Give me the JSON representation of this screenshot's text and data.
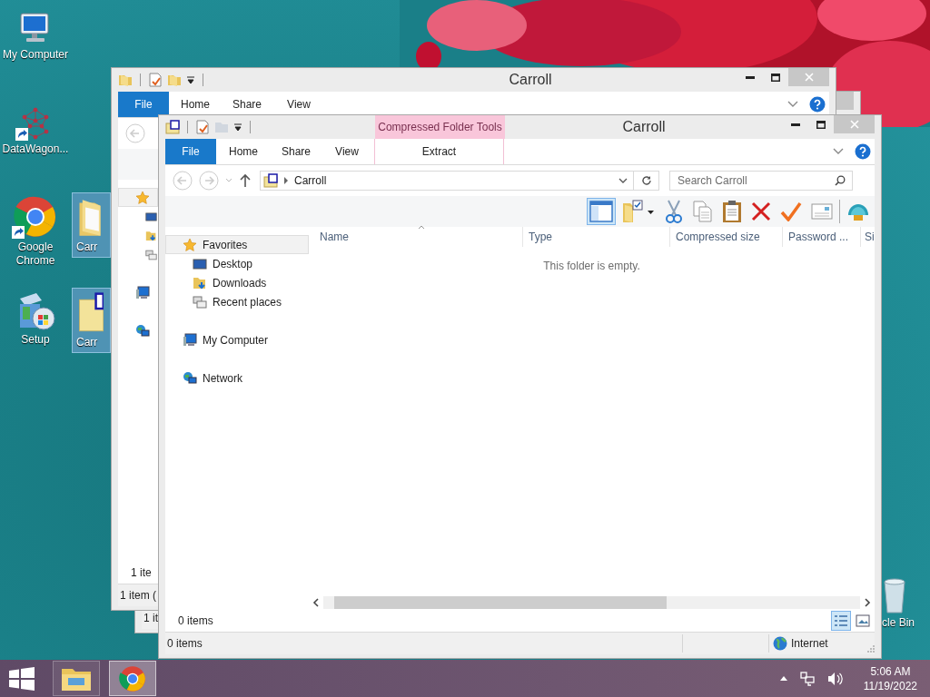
{
  "desktop_icons": [
    {
      "label": "My Computer",
      "kind": "computer",
      "selected": false,
      "shortcut": false
    },
    {
      "label": "DataWagon...",
      "kind": "mesh",
      "selected": false,
      "shortcut": true
    },
    {
      "label": "Google Chrome",
      "kind": "chrome",
      "selected": false,
      "shortcut": true
    },
    {
      "label": "Setup",
      "kind": "setup",
      "selected": false,
      "shortcut": false
    },
    {
      "label": "Carr",
      "kind": "folder",
      "selected": true,
      "shortcut": false
    },
    {
      "label": "Carr",
      "kind": "zip-folder",
      "selected": true,
      "shortcut": false
    },
    {
      "label": "cle Bin",
      "kind": "recycle-bin",
      "selected": false,
      "shortcut": false
    }
  ],
  "third_window": {
    "status": "1 it"
  },
  "back_window": {
    "title": "Carroll",
    "tabs": [
      {
        "label": "File",
        "kind": "file"
      },
      {
        "label": "Home",
        "kind": "tab"
      },
      {
        "label": "Share",
        "kind": "tab"
      },
      {
        "label": "View",
        "kind": "tab"
      }
    ],
    "item_count": "1 ite",
    "status": "1 item ("
  },
  "front_window": {
    "title": "Carroll",
    "context_group": "Compressed Folder Tools",
    "tabs": [
      {
        "label": "File",
        "kind": "file"
      },
      {
        "label": "Home",
        "kind": "tab"
      },
      {
        "label": "Share",
        "kind": "tab"
      },
      {
        "label": "View",
        "kind": "tab"
      },
      {
        "label": "Extract",
        "kind": "contextual"
      }
    ],
    "address": "Carroll",
    "search_placeholder": "Search Carroll",
    "toolbar": [
      {
        "kind": "pane",
        "selected": true
      },
      {
        "kind": "folder-check",
        "selected": false
      },
      {
        "kind": "cut",
        "selected": false
      },
      {
        "kind": "copy",
        "selected": false
      },
      {
        "kind": "paste",
        "selected": false
      },
      {
        "kind": "delete",
        "selected": false
      },
      {
        "kind": "check",
        "selected": false
      },
      {
        "kind": "card",
        "selected": false
      },
      {
        "kind": "shell",
        "selected": false
      }
    ],
    "nav": [
      {
        "label": "Favorites",
        "kind": "favorites",
        "selected": true,
        "children": [
          {
            "label": "Desktop",
            "kind": "desktop",
            "selected": false
          },
          {
            "label": "Downloads",
            "kind": "downloads",
            "selected": false
          },
          {
            "label": "Recent places",
            "kind": "recent",
            "selected": false
          }
        ]
      },
      {
        "label": "My Computer",
        "kind": "computer",
        "selected": false
      },
      {
        "label": "Network",
        "kind": "network",
        "selected": false
      }
    ],
    "columns": [
      {
        "label": "Name",
        "sorted": true
      },
      {
        "label": "Type",
        "sorted": false
      },
      {
        "label": "Compressed size",
        "sorted": false
      },
      {
        "label": "Password ...",
        "sorted": false
      },
      {
        "label": "Si",
        "sorted": false
      }
    ],
    "empty_message": "This folder is empty.",
    "item_count": "0 items",
    "views": [
      {
        "kind": "details",
        "selected": true
      },
      {
        "kind": "large-icons",
        "selected": false
      }
    ],
    "status": "0 items",
    "zone": "Internet"
  },
  "taskbar": {
    "apps": [
      {
        "kind": "explorer",
        "selected": false
      },
      {
        "kind": "chrome",
        "selected": true
      }
    ],
    "time": "5:06 AM",
    "date": "11/19/2022"
  }
}
